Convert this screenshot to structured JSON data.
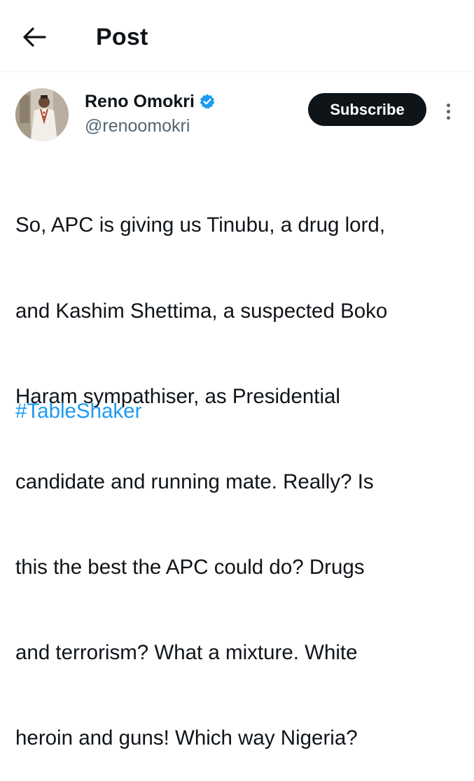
{
  "header": {
    "back_icon": "arrow-left-icon",
    "title": "Post"
  },
  "author": {
    "display_name": "Reno Omokri",
    "handle": "@renoomokri",
    "verified": true,
    "verified_icon": "verified-badge-icon",
    "verified_color": "#1d9bf0"
  },
  "actions": {
    "subscribe_label": "Subscribe",
    "more_icon": "more-vertical-icon"
  },
  "post": {
    "lines": [
      "So, APC is giving us Tinubu, a drug lord,",
      "and Kashim Shettima, a suspected Boko",
      "Haram sympathiser, as Presidential",
      "candidate and running mate. Really? Is",
      "this the best the APC could do? Drugs",
      "and terrorism? What a mixture. White",
      "heroin and guns! Which way Nigeria?"
    ],
    "hashtag": "#TableShaker",
    "hashtag_color": "#1d9bf0"
  }
}
